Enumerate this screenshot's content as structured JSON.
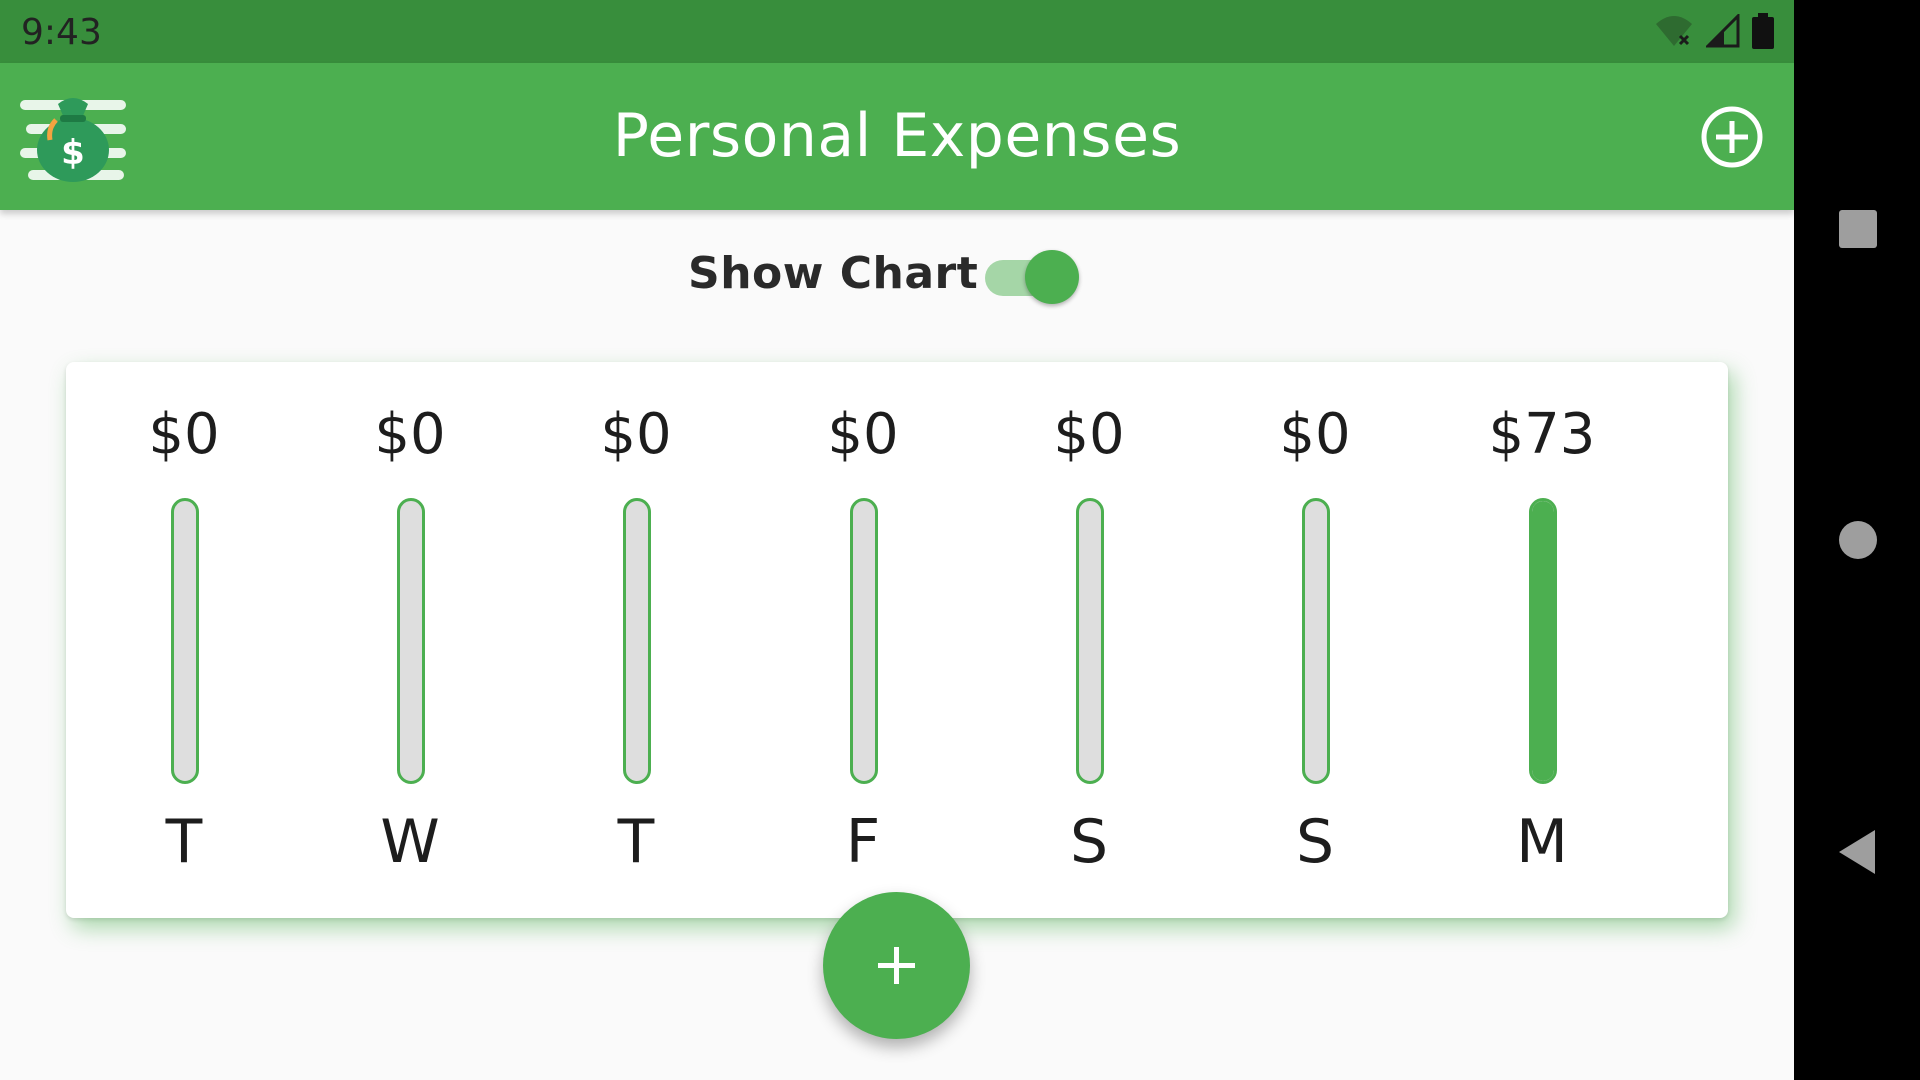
{
  "status_bar": {
    "time": "9:43",
    "icons": [
      "wifi-icon",
      "signal-icon",
      "battery-icon"
    ]
  },
  "app_bar": {
    "title": "Personal Expenses",
    "logo_icon": "money-bag-icon",
    "action_icon": "add-circle-icon"
  },
  "toggle": {
    "label": "Show Chart",
    "checked": true
  },
  "chart_data": {
    "type": "bar",
    "categories": [
      "T",
      "W",
      "T",
      "F",
      "S",
      "S",
      "M"
    ],
    "amounts_labels": [
      "$0",
      "$0",
      "$0",
      "$0",
      "$0",
      "$0",
      "$73"
    ],
    "values": [
      0,
      0,
      0,
      0,
      0,
      0,
      73
    ],
    "fill_fraction": [
      0,
      0,
      0,
      0,
      0,
      0,
      1.0
    ]
  },
  "fab": {
    "icon": "plus-icon"
  },
  "nav_bar": {
    "icons": [
      "recents-square-icon",
      "home-circle-icon",
      "back-triangle-icon"
    ]
  },
  "colors": {
    "primary": "#4caf50",
    "primary_dark": "#388e3c",
    "accent_light": "#a5d6a7",
    "bar_empty": "#dedede"
  }
}
